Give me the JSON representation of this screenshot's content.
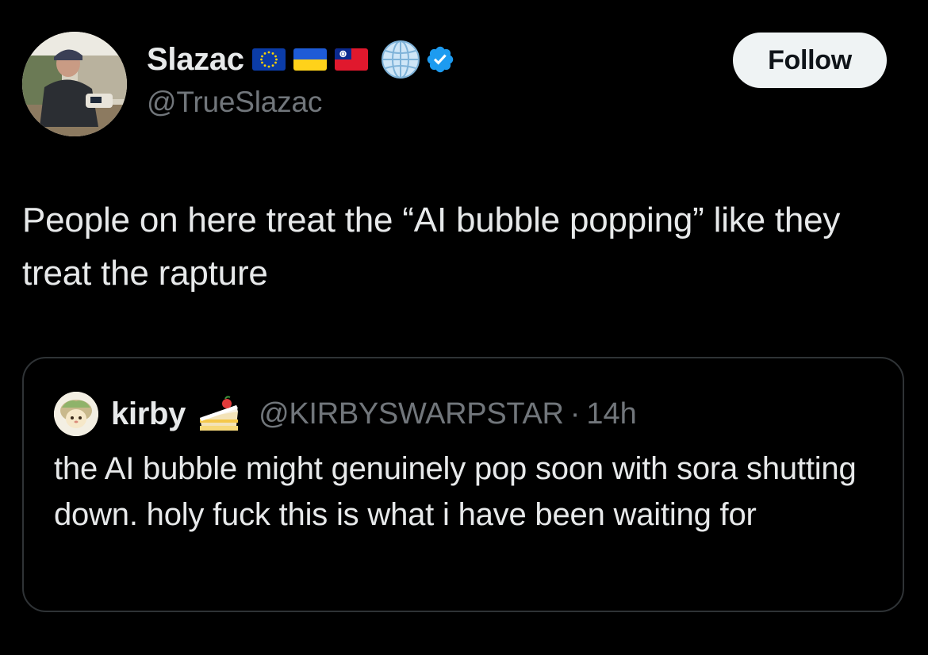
{
  "author": {
    "display_name": "Slazac",
    "handle": "@TrueSlazac",
    "badges": [
      "eu-flag-icon",
      "ukraine-flag-icon",
      "taiwan-flag-icon",
      "globe-icon",
      "verified-icon"
    ],
    "verified_color": "#1d9bf0"
  },
  "follow_button": {
    "label": "Follow"
  },
  "tweet": {
    "text": "People on here treat the “AI bubble popping” like they treat the rapture"
  },
  "quoted_tweet": {
    "display_name": "kirby",
    "name_emoji": "cake-icon",
    "handle": "@KIRBYSWARPSTAR",
    "separator": "·",
    "time": "14h",
    "text": "the AI bubble might genuinely pop soon with sora shutting down. holy fuck this is what i have been waiting for"
  },
  "colors": {
    "background": "#000000",
    "primary_text": "#e7e9ea",
    "secondary_text": "#71767b",
    "border": "#2f3336",
    "follow_bg": "#eff3f4"
  }
}
